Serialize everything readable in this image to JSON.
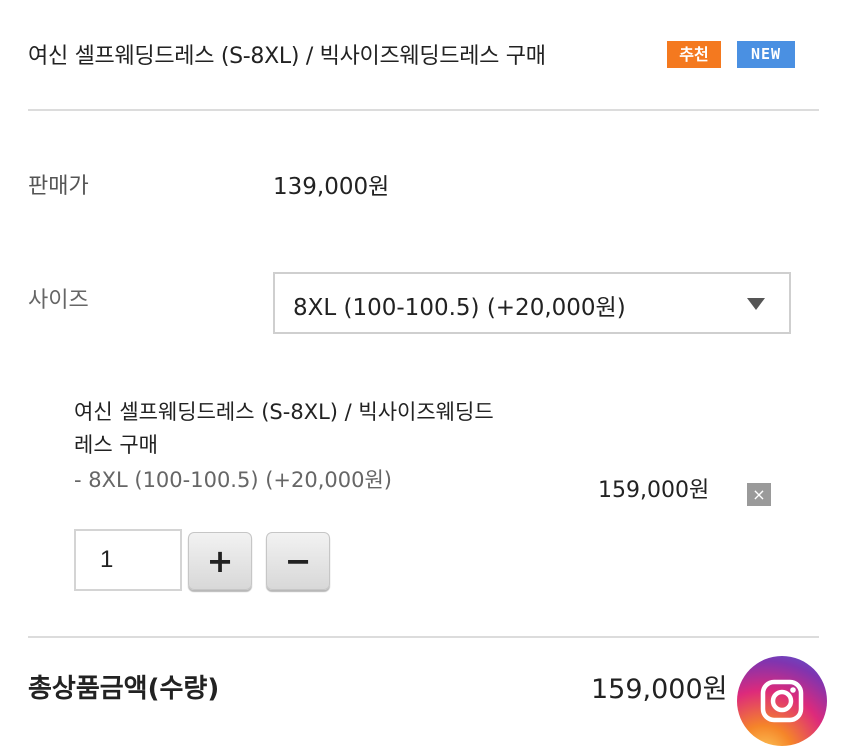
{
  "product": {
    "title": "여신 셀프웨딩드레스 (S-8XL) / 빅사이즈웨딩드레스 구매",
    "badge_recommend": "추천",
    "badge_new": "NEW"
  },
  "price": {
    "label": "판매가",
    "value": "139,000원"
  },
  "size": {
    "label": "사이즈",
    "selected": "8XL (100-100.5) (+20,000원)"
  },
  "selected_item": {
    "name": "여신 셀프웨딩드레스 (S-8XL) / 빅사이즈웨딩드레스 구매",
    "option": "- 8XL (100-100.5) (+20,000원)",
    "price": "159,000원",
    "remove_label": "×",
    "quantity": "1",
    "plus_label": "+",
    "minus_label": "−"
  },
  "total": {
    "label": "총상품금액(수량)",
    "value": "159,000원"
  },
  "icons": {
    "dropdown": "chevron-down-icon",
    "remove": "close-icon",
    "social": "instagram-icon"
  },
  "colors": {
    "badge_recommend": "#f4791f",
    "badge_new": "#4a90e2"
  }
}
